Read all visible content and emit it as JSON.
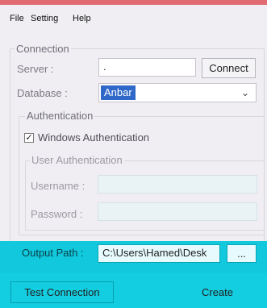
{
  "menu": [
    "File",
    "Setting",
    "Help"
  ],
  "connection": {
    "title": "Connection",
    "server_label": "Server :",
    "server_value": ".",
    "connect_label": "Connect",
    "database_label": "Database :",
    "database_value": "Anbar"
  },
  "authentication": {
    "title": "Authentication",
    "windows_auth_label": "Windows Authentication",
    "windows_auth_checked": true,
    "user_auth_title": "User Authentication",
    "username_label": "Username :",
    "password_label": "Password :"
  },
  "output": {
    "label": "Output Path :",
    "path_value": "C:\\Users\\Hamed\\Desk",
    "browse_label": "..."
  },
  "actions": {
    "test_label": "Test Connection",
    "create_label": "Create"
  },
  "colors": {
    "accent_top": "#e26a72",
    "band": "#13cde0",
    "selection": "#2f68c8"
  }
}
